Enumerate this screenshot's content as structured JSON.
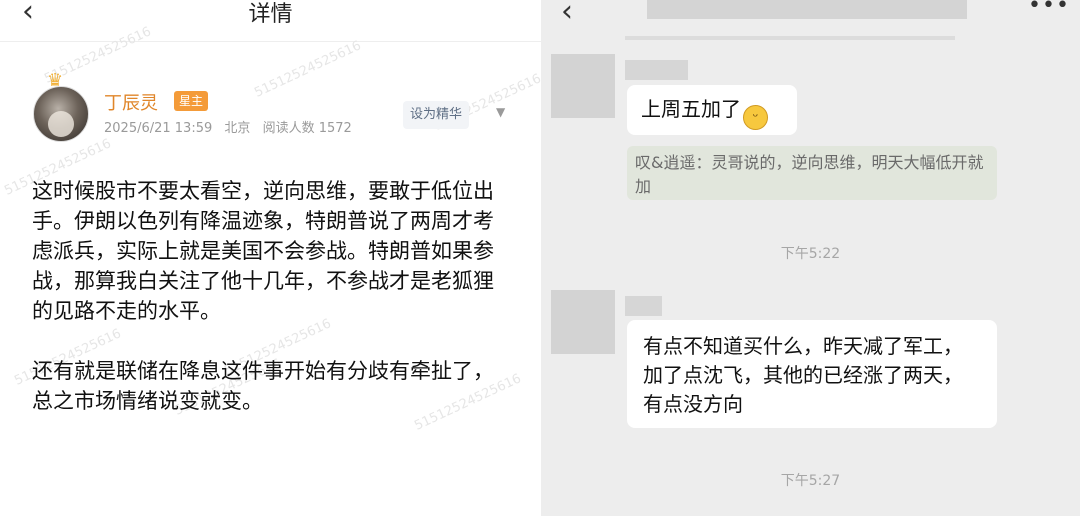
{
  "left": {
    "header": {
      "back_icon": "‹",
      "title": "详情"
    },
    "post": {
      "author": "丁辰灵",
      "badge": "星主",
      "date": "2025/6/21 13:59",
      "location": "北京",
      "reads": "阅读人数 1572",
      "featured_button": "设为精华",
      "paragraphs": [
        "这时候股市不要太看空，逆向思维，要敢于低位出手。伊朗以色列有降温迹象，特朗普说了两周才考虑派兵，实际上就是美国不会参战。特朗普如果参战，那算我白关注了他十几年，不参战才是老狐狸的见路不走的水平。",
        "还有就是联储在降息这件事开始有分歧有牵扯了，总之市场情绪说变就变。"
      ]
    },
    "watermark": "51512524525616"
  },
  "right": {
    "header": {
      "back_icon": "‹",
      "menu_icon": "•••"
    },
    "messages": [
      {
        "text": "上周五加了",
        "emoji": "grinning-face-emoji",
        "quote": "叹&逍遥：灵哥说的，逆向思维，明天大幅低开就加"
      },
      {
        "time": "下午5:22",
        "text": "有点不知道买什么，昨天减了军工，加了点沈飞，其他的已经涨了两天，有点没方向"
      },
      {
        "time": "下午5:27"
      }
    ]
  }
}
